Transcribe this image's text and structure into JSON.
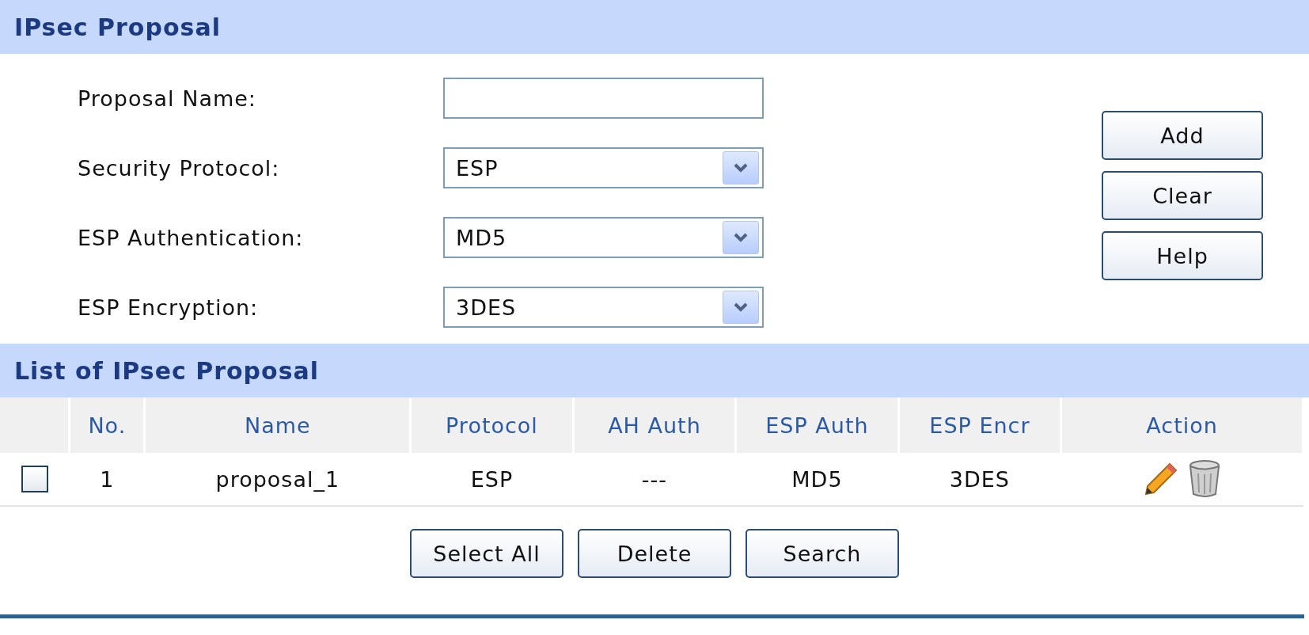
{
  "section_title": "IPsec Proposal",
  "form_fields": [
    {
      "label": "Proposal Name:",
      "kind": "text"
    },
    {
      "label": "Security Protocol:",
      "kind": "select",
      "value": "ESP"
    },
    {
      "label": "ESP Authentication:",
      "kind": "select",
      "value": "MD5"
    },
    {
      "label": "ESP Encryption:",
      "kind": "select",
      "value": "3DES"
    }
  ],
  "side_buttons": [
    "Add",
    "Clear",
    "Help"
  ],
  "list_title": "List of IPsec Proposal",
  "table": {
    "columns": [
      "No.",
      "Name",
      "Protocol",
      "AH Auth",
      "ESP Auth",
      "ESP Encr",
      "Action"
    ],
    "rows": [
      {
        "checked": false,
        "cells": [
          "1",
          "proposal_1",
          "ESP",
          "---",
          "MD5",
          "3DES"
        ]
      }
    ]
  },
  "bottom_buttons": [
    "Select All",
    "Delete",
    "Search"
  ]
}
